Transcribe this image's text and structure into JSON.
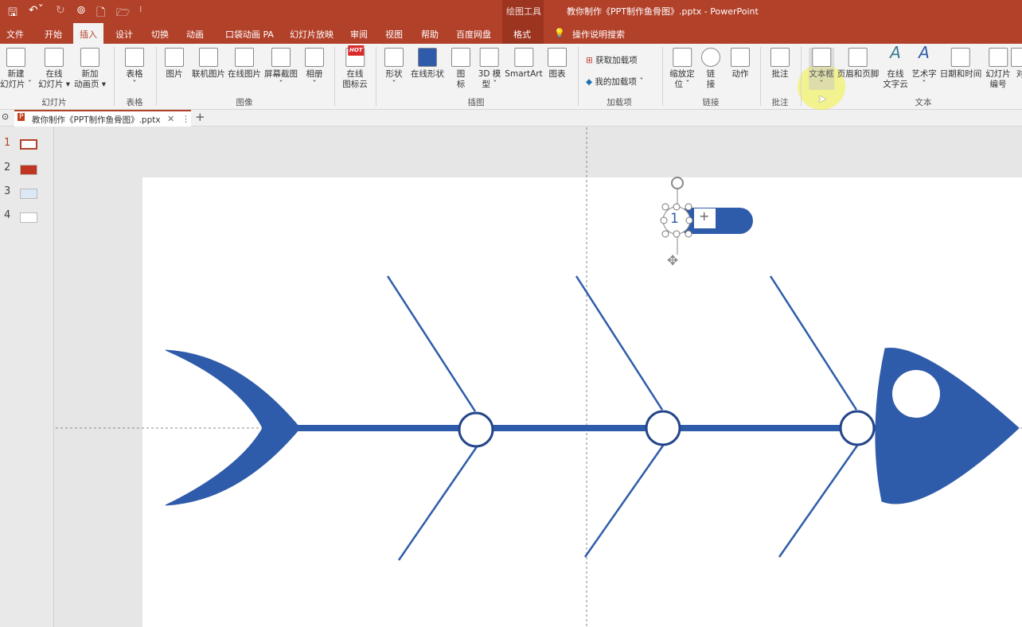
{
  "window": {
    "title": "教你制作《PPT制作鱼骨图》.pptx  -  PowerPoint",
    "context_tool": "绘图工具"
  },
  "quick_access": {
    "save": "save-icon",
    "undo": "undo-icon",
    "redo": "redo-icon",
    "present": "present-icon",
    "new": "new-file-icon",
    "open": "open-folder-icon",
    "more": "⁝"
  },
  "tabs": [
    "文件",
    "开始",
    "插入",
    "设计",
    "切换",
    "动画",
    "口袋动画 PA",
    "幻灯片放映",
    "审阅",
    "视图",
    "帮助",
    "百度网盘",
    "格式"
  ],
  "active_tab": "插入",
  "search": "操作说明搜索",
  "ribbon": {
    "items": [
      "新建\n幻灯片 ˇ",
      "在线\n幻灯片 ▾",
      "新加\n动画页 ▾",
      "表格\nˇ",
      "图片",
      "联机图片",
      "在线图片",
      "屏幕截图\nˇ",
      "相册\nˇ",
      "在线\n图标云",
      "形状\nˇ",
      "在线形状",
      "图\n标",
      "3D 模\n型 ˇ",
      "SmartArt",
      "图表",
      "缩放定\n位 ˇ",
      "链\n接",
      "动作",
      "批注",
      "文本框\nˇ",
      "页眉和页脚",
      "在线\n文字云",
      "艺术字\nˇ",
      "日期和时间",
      "幻灯片\n编号",
      "对"
    ],
    "addins": [
      "获取加载项",
      "我的加载项  ˇ"
    ],
    "hot_badge": "HOT",
    "groups": [
      "幻灯片",
      "表格",
      "图像",
      "插图",
      "加载项",
      "链接",
      "批注",
      "文本"
    ]
  },
  "doc_tab": {
    "name": "教你制作《PPT制作鱼骨图》.pptx",
    "close": "✕",
    "menu": "⋮",
    "add": "+"
  },
  "slides": [
    "1",
    "2",
    "3",
    "4"
  ],
  "active_slide": "1",
  "canvas": {
    "selected_shape_text": "1",
    "plus": "+",
    "fish_color": "#2f5caa"
  },
  "colors": {
    "title_bar": "#b2412a",
    "ribbon": "#f3f3f3",
    "fish": "#2f5caa"
  }
}
